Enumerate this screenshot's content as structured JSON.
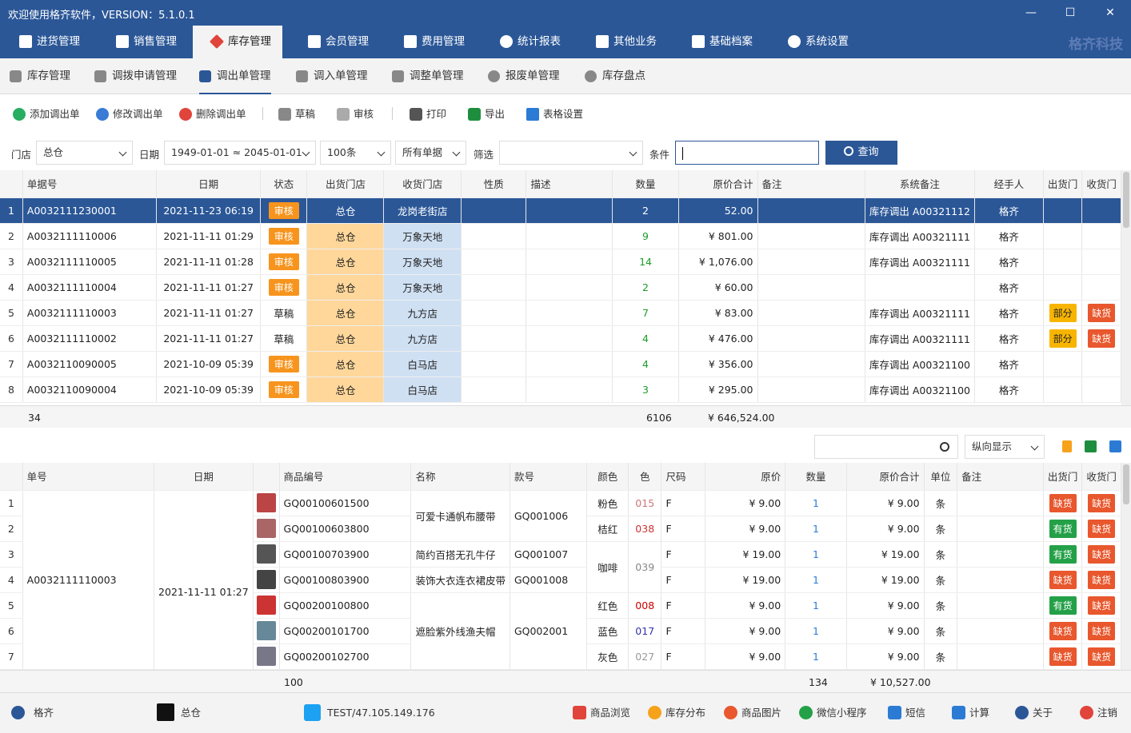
{
  "window": {
    "title": "欢迎使用格齐软件，VERSION：5.1.0.1",
    "brand": "格齐科技",
    "min": "—",
    "max": "☐",
    "close": "✕"
  },
  "menu": [
    "进货管理",
    "销售管理",
    "库存管理",
    "会员管理",
    "费用管理",
    "统计报表",
    "其他业务",
    "基础档案",
    "系统设置"
  ],
  "submenu": [
    "库存管理",
    "调拨申请管理",
    "调出单管理",
    "调入单管理",
    "调整单管理",
    "报废单管理",
    "库存盘点"
  ],
  "toolbar": [
    "添加调出单",
    "修改调出单",
    "删除调出单",
    "草稿",
    "审核",
    "打印",
    "导出",
    "表格设置"
  ],
  "filter": {
    "store_label": "门店",
    "store": "总仓",
    "date_label": "日期",
    "date": "1949-01-01 ≈ 2045-01-01",
    "count": "100条",
    "docs": "所有单据",
    "screen_label": "筛选",
    "screen": "",
    "cond_label": "条件",
    "cond": "",
    "query": "查询"
  },
  "upper": {
    "headers": [
      "单据号",
      "日期",
      "状态",
      "出货门店",
      "收货门店",
      "性质",
      "描述",
      "数量",
      "原价合计",
      "备注",
      "系统备注",
      "经手人",
      "出货门",
      "收货门"
    ],
    "rows": [
      [
        "1",
        "A0032111230001",
        "2021-11-23 06:19",
        "审核",
        "总仓",
        "龙岗老街店",
        "",
        "",
        "2",
        "52.00",
        "",
        "库存调出 A00321112",
        "格齐",
        "",
        ""
      ],
      [
        "2",
        "A0032111110006",
        "2021-11-11 01:29",
        "审核",
        "总仓",
        "万象天地",
        "",
        "",
        "9",
        "¥ 801.00",
        "",
        "库存调出 A00321111",
        "格齐",
        "",
        ""
      ],
      [
        "3",
        "A0032111110005",
        "2021-11-11 01:28",
        "审核",
        "总仓",
        "万象天地",
        "",
        "",
        "14",
        "¥ 1,076.00",
        "",
        "库存调出 A00321111",
        "格齐",
        "",
        ""
      ],
      [
        "4",
        "A0032111110004",
        "2021-11-11 01:27",
        "审核",
        "总仓",
        "万象天地",
        "",
        "",
        "2",
        "¥ 60.00",
        "",
        "",
        "格齐",
        "",
        ""
      ],
      [
        "5",
        "A0032111110003",
        "2021-11-11 01:27",
        "草稿",
        "总仓",
        "九方店",
        "",
        "",
        "7",
        "¥ 83.00",
        "",
        "库存调出 A00321111",
        "格齐",
        "部分",
        "缺货"
      ],
      [
        "6",
        "A0032111110002",
        "2021-11-11 01:27",
        "草稿",
        "总仓",
        "九方店",
        "",
        "",
        "4",
        "¥ 476.00",
        "",
        "库存调出 A00321111",
        "格齐",
        "部分",
        "缺货"
      ],
      [
        "7",
        "A0032110090005",
        "2021-10-09 05:39",
        "审核",
        "总仓",
        "白马店",
        "",
        "",
        "4",
        "¥ 356.00",
        "",
        "库存调出 A00321100",
        "格齐",
        "",
        ""
      ],
      [
        "8",
        "A0032110090004",
        "2021-10-09 05:39",
        "审核",
        "总仓",
        "白马店",
        "",
        "",
        "3",
        "¥ 295.00",
        "",
        "库存调出 A00321100",
        "格齐",
        "",
        ""
      ]
    ],
    "summary": {
      "count": "34",
      "qty": "6106",
      "total": "¥ 646,524.00"
    }
  },
  "detail_tools": {
    "search": "",
    "view": "纵向显示"
  },
  "lower": {
    "headers": [
      "单号",
      "日期",
      "",
      "商品编号",
      "名称",
      "款号",
      "颜色",
      "色",
      "尺码",
      "原价",
      "数量",
      "原价合计",
      "单位",
      "备注",
      "出货门",
      "收货门"
    ],
    "doc": "A0032111110003",
    "date": "2021-11-11 01:27",
    "rows": [
      [
        "1",
        "GQ00100601500",
        "",
        "",
        "粉色",
        "015",
        "F",
        "¥ 9.00",
        "1",
        "¥ 9.00",
        "条",
        "缺货",
        "缺货"
      ],
      [
        "2",
        "GQ00100603800",
        "",
        "",
        "桔红",
        "038",
        "F",
        "¥ 9.00",
        "1",
        "¥ 9.00",
        "条",
        "有货",
        "缺货"
      ],
      [
        "3",
        "GQ00100703900",
        "简约百搭无孔牛仔",
        "GQ001007",
        "",
        "",
        "F",
        "¥ 19.00",
        "1",
        "¥ 19.00",
        "条",
        "有货",
        "缺货"
      ],
      [
        "4",
        "GQ00100803900",
        "装饰大衣连衣裙皮带",
        "GQ001008",
        "",
        "",
        "F",
        "¥ 19.00",
        "1",
        "¥ 19.00",
        "条",
        "缺货",
        "缺货"
      ],
      [
        "5",
        "GQ00200100800",
        "",
        "",
        "红色",
        "008",
        "F",
        "¥ 9.00",
        "1",
        "¥ 9.00",
        "条",
        "有货",
        "缺货"
      ],
      [
        "6",
        "GQ00200101700",
        "",
        "",
        "蓝色",
        "017",
        "F",
        "¥ 9.00",
        "1",
        "¥ 9.00",
        "条",
        "缺货",
        "缺货"
      ],
      [
        "7",
        "GQ00200102700",
        "",
        "",
        "灰色",
        "027",
        "F",
        "¥ 9.00",
        "1",
        "¥ 9.00",
        "条",
        "缺货",
        "缺货"
      ]
    ],
    "merged": {
      "name1": "可爱卡通帆布腰带",
      "style1": "GQ001006",
      "color34": "咖啡",
      "code34": "039",
      "name2": "遮脸紫外线渔夫帽",
      "style2": "GQ002001"
    },
    "summary": {
      "count": "100",
      "qty": "134",
      "total": "¥ 10,527.00"
    }
  },
  "footer": [
    "格齐",
    "总仓",
    "TEST/47.105.149.176",
    "商品浏览",
    "库存分布",
    "商品图片",
    "微信小程序",
    "短信",
    "计算",
    "关于",
    "注销"
  ]
}
